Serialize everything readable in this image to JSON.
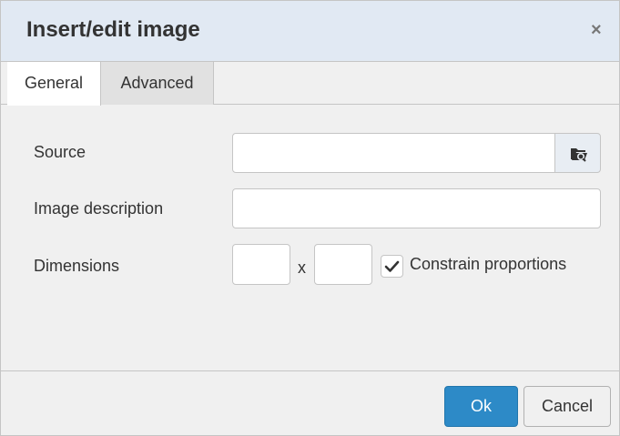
{
  "dialog": {
    "title": "Insert/edit image",
    "close_label": "×"
  },
  "tabs": [
    {
      "label": "General",
      "active": true
    },
    {
      "label": "Advanced",
      "active": false
    }
  ],
  "form": {
    "source_label": "Source",
    "source_value": "",
    "browse_icon": "folder-search-icon",
    "description_label": "Image description",
    "description_value": "",
    "dimensions_label": "Dimensions",
    "width_value": "",
    "height_value": "",
    "times_sign": "x",
    "constrain_label": "Constrain proportions",
    "constrain_checked": true
  },
  "footer": {
    "ok_label": "Ok",
    "cancel_label": "Cancel"
  },
  "colors": {
    "titlebar": "#e1e9f3",
    "primary": "#2d8ac7",
    "border": "#c5c5c5"
  }
}
